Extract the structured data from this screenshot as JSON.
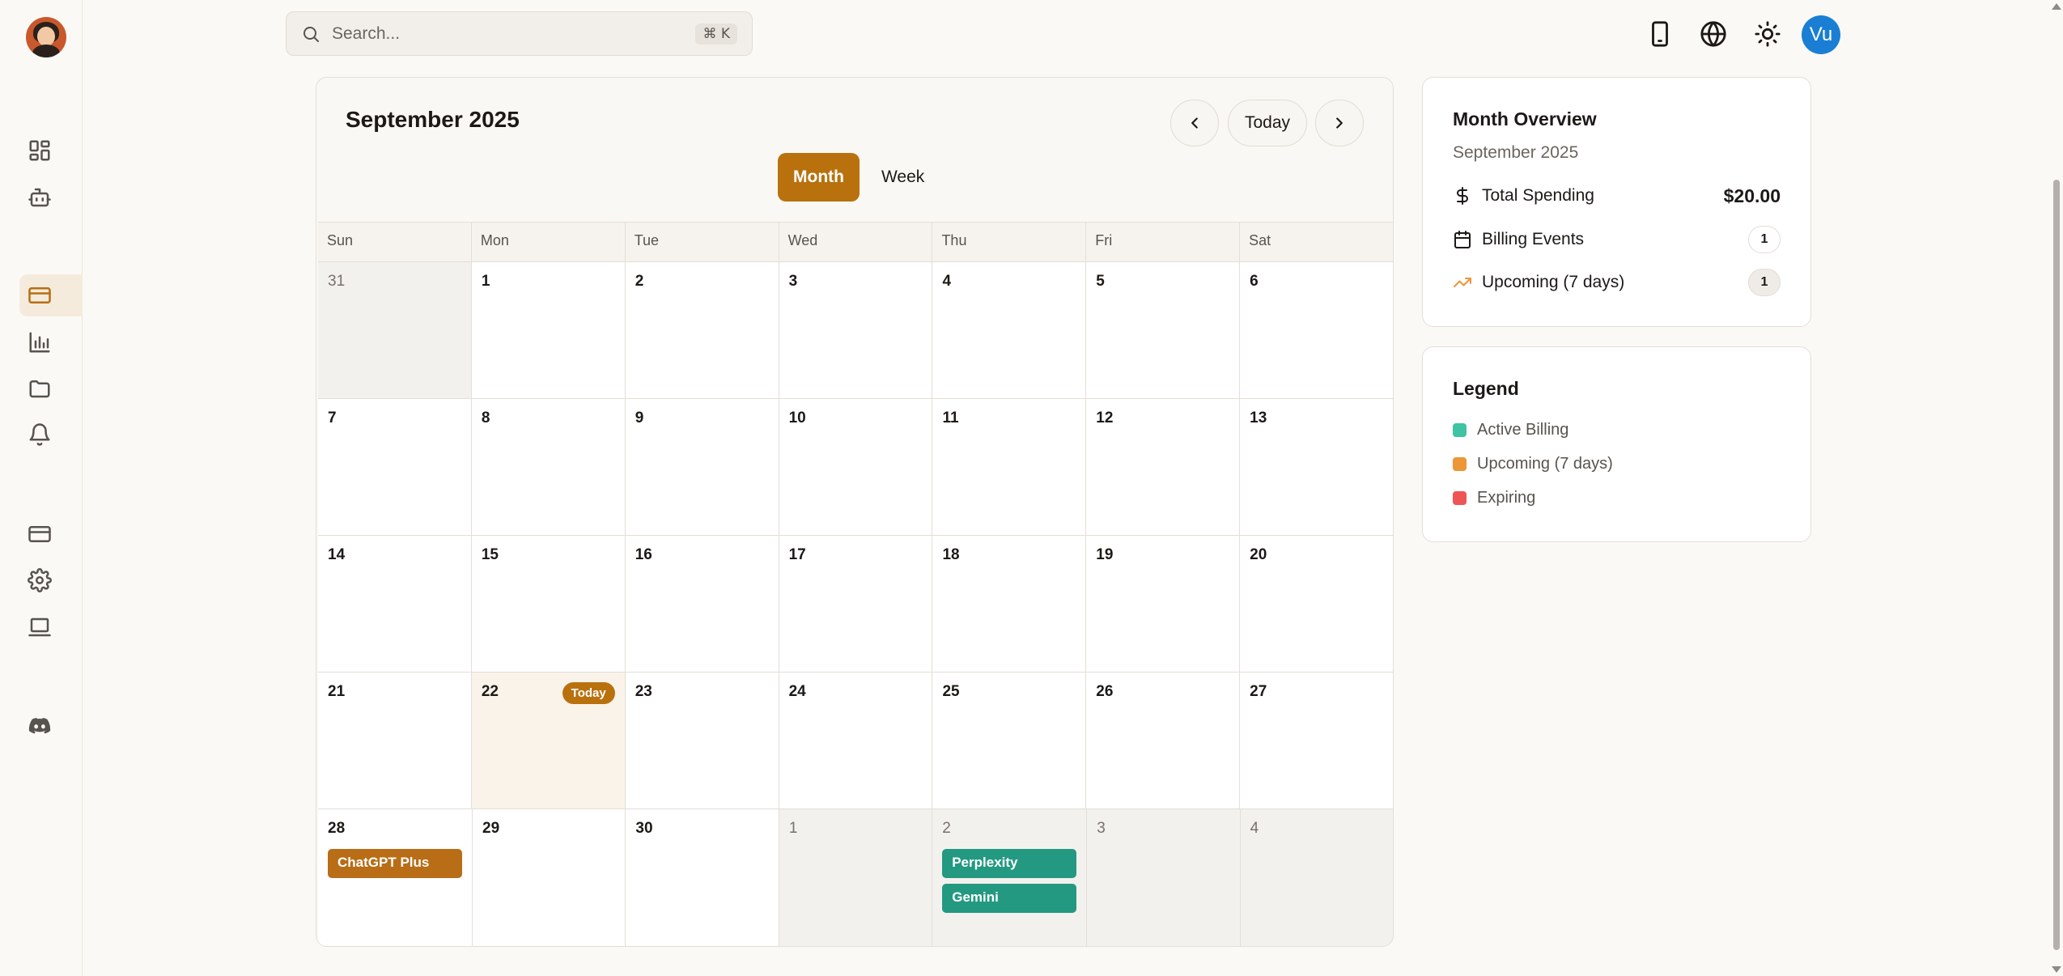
{
  "sidebar": {
    "items": [
      {
        "icon": "layout-dashboard-icon"
      },
      {
        "icon": "bot-icon"
      },
      {
        "icon": "credit-card-icon",
        "active": true
      },
      {
        "icon": "bar-chart-icon"
      },
      {
        "icon": "folder-icon"
      },
      {
        "icon": "bell-icon"
      },
      {
        "icon": "credit-card-icon"
      },
      {
        "icon": "gear-icon"
      },
      {
        "icon": "laptop-icon"
      },
      {
        "icon": "discord-icon"
      }
    ]
  },
  "header": {
    "search_placeholder": "Search...",
    "search_shortcut": "⌘ K",
    "user_initials": "Vu",
    "icons": [
      "mobile-icon",
      "globe-icon",
      "sun-icon"
    ]
  },
  "calendar": {
    "title": "September 2025",
    "today_button": "Today",
    "views": [
      "Month",
      "Week"
    ],
    "active_view": "Month",
    "weekdays": [
      "Sun",
      "Mon",
      "Tue",
      "Wed",
      "Thu",
      "Fri",
      "Sat"
    ],
    "today_badge": "Today",
    "weeks": [
      [
        {
          "n": "31",
          "outside": true
        },
        {
          "n": "1"
        },
        {
          "n": "2"
        },
        {
          "n": "3"
        },
        {
          "n": "4"
        },
        {
          "n": "5"
        },
        {
          "n": "6"
        }
      ],
      [
        {
          "n": "7"
        },
        {
          "n": "8"
        },
        {
          "n": "9"
        },
        {
          "n": "10"
        },
        {
          "n": "11"
        },
        {
          "n": "12"
        },
        {
          "n": "13"
        }
      ],
      [
        {
          "n": "14"
        },
        {
          "n": "15"
        },
        {
          "n": "16"
        },
        {
          "n": "17"
        },
        {
          "n": "18"
        },
        {
          "n": "19"
        },
        {
          "n": "20"
        }
      ],
      [
        {
          "n": "21"
        },
        {
          "n": "22",
          "today": true
        },
        {
          "n": "23"
        },
        {
          "n": "24"
        },
        {
          "n": "25"
        },
        {
          "n": "26"
        },
        {
          "n": "27"
        }
      ],
      [
        {
          "n": "28",
          "events": [
            {
              "label": "ChatGPT Plus",
              "status": "upcoming"
            }
          ]
        },
        {
          "n": "29"
        },
        {
          "n": "30"
        },
        {
          "n": "1",
          "outside": true
        },
        {
          "n": "2",
          "outside": true,
          "events": [
            {
              "label": "Perplexity",
              "status": "active"
            },
            {
              "label": "Gemini",
              "status": "active"
            }
          ]
        },
        {
          "n": "3",
          "outside": true
        },
        {
          "n": "4",
          "outside": true
        }
      ]
    ]
  },
  "overview": {
    "title": "Month Overview",
    "subtitle": "September 2025",
    "total_spending_label": "Total Spending",
    "total_spending_value": "$20.00",
    "billing_events_label": "Billing Events",
    "billing_events_value": "1",
    "upcoming_label": "Upcoming (7 days)",
    "upcoming_value": "1"
  },
  "legend": {
    "title": "Legend",
    "items": [
      {
        "label": "Active Billing",
        "color": "#3ec3a3"
      },
      {
        "label": "Upcoming (7 days)",
        "color": "#ee9536"
      },
      {
        "label": "Expiring",
        "color": "#ee5555"
      }
    ]
  },
  "colors": {
    "accent": "#b9710e",
    "active_event": "#239981",
    "upcoming_event": "#b86d16"
  }
}
